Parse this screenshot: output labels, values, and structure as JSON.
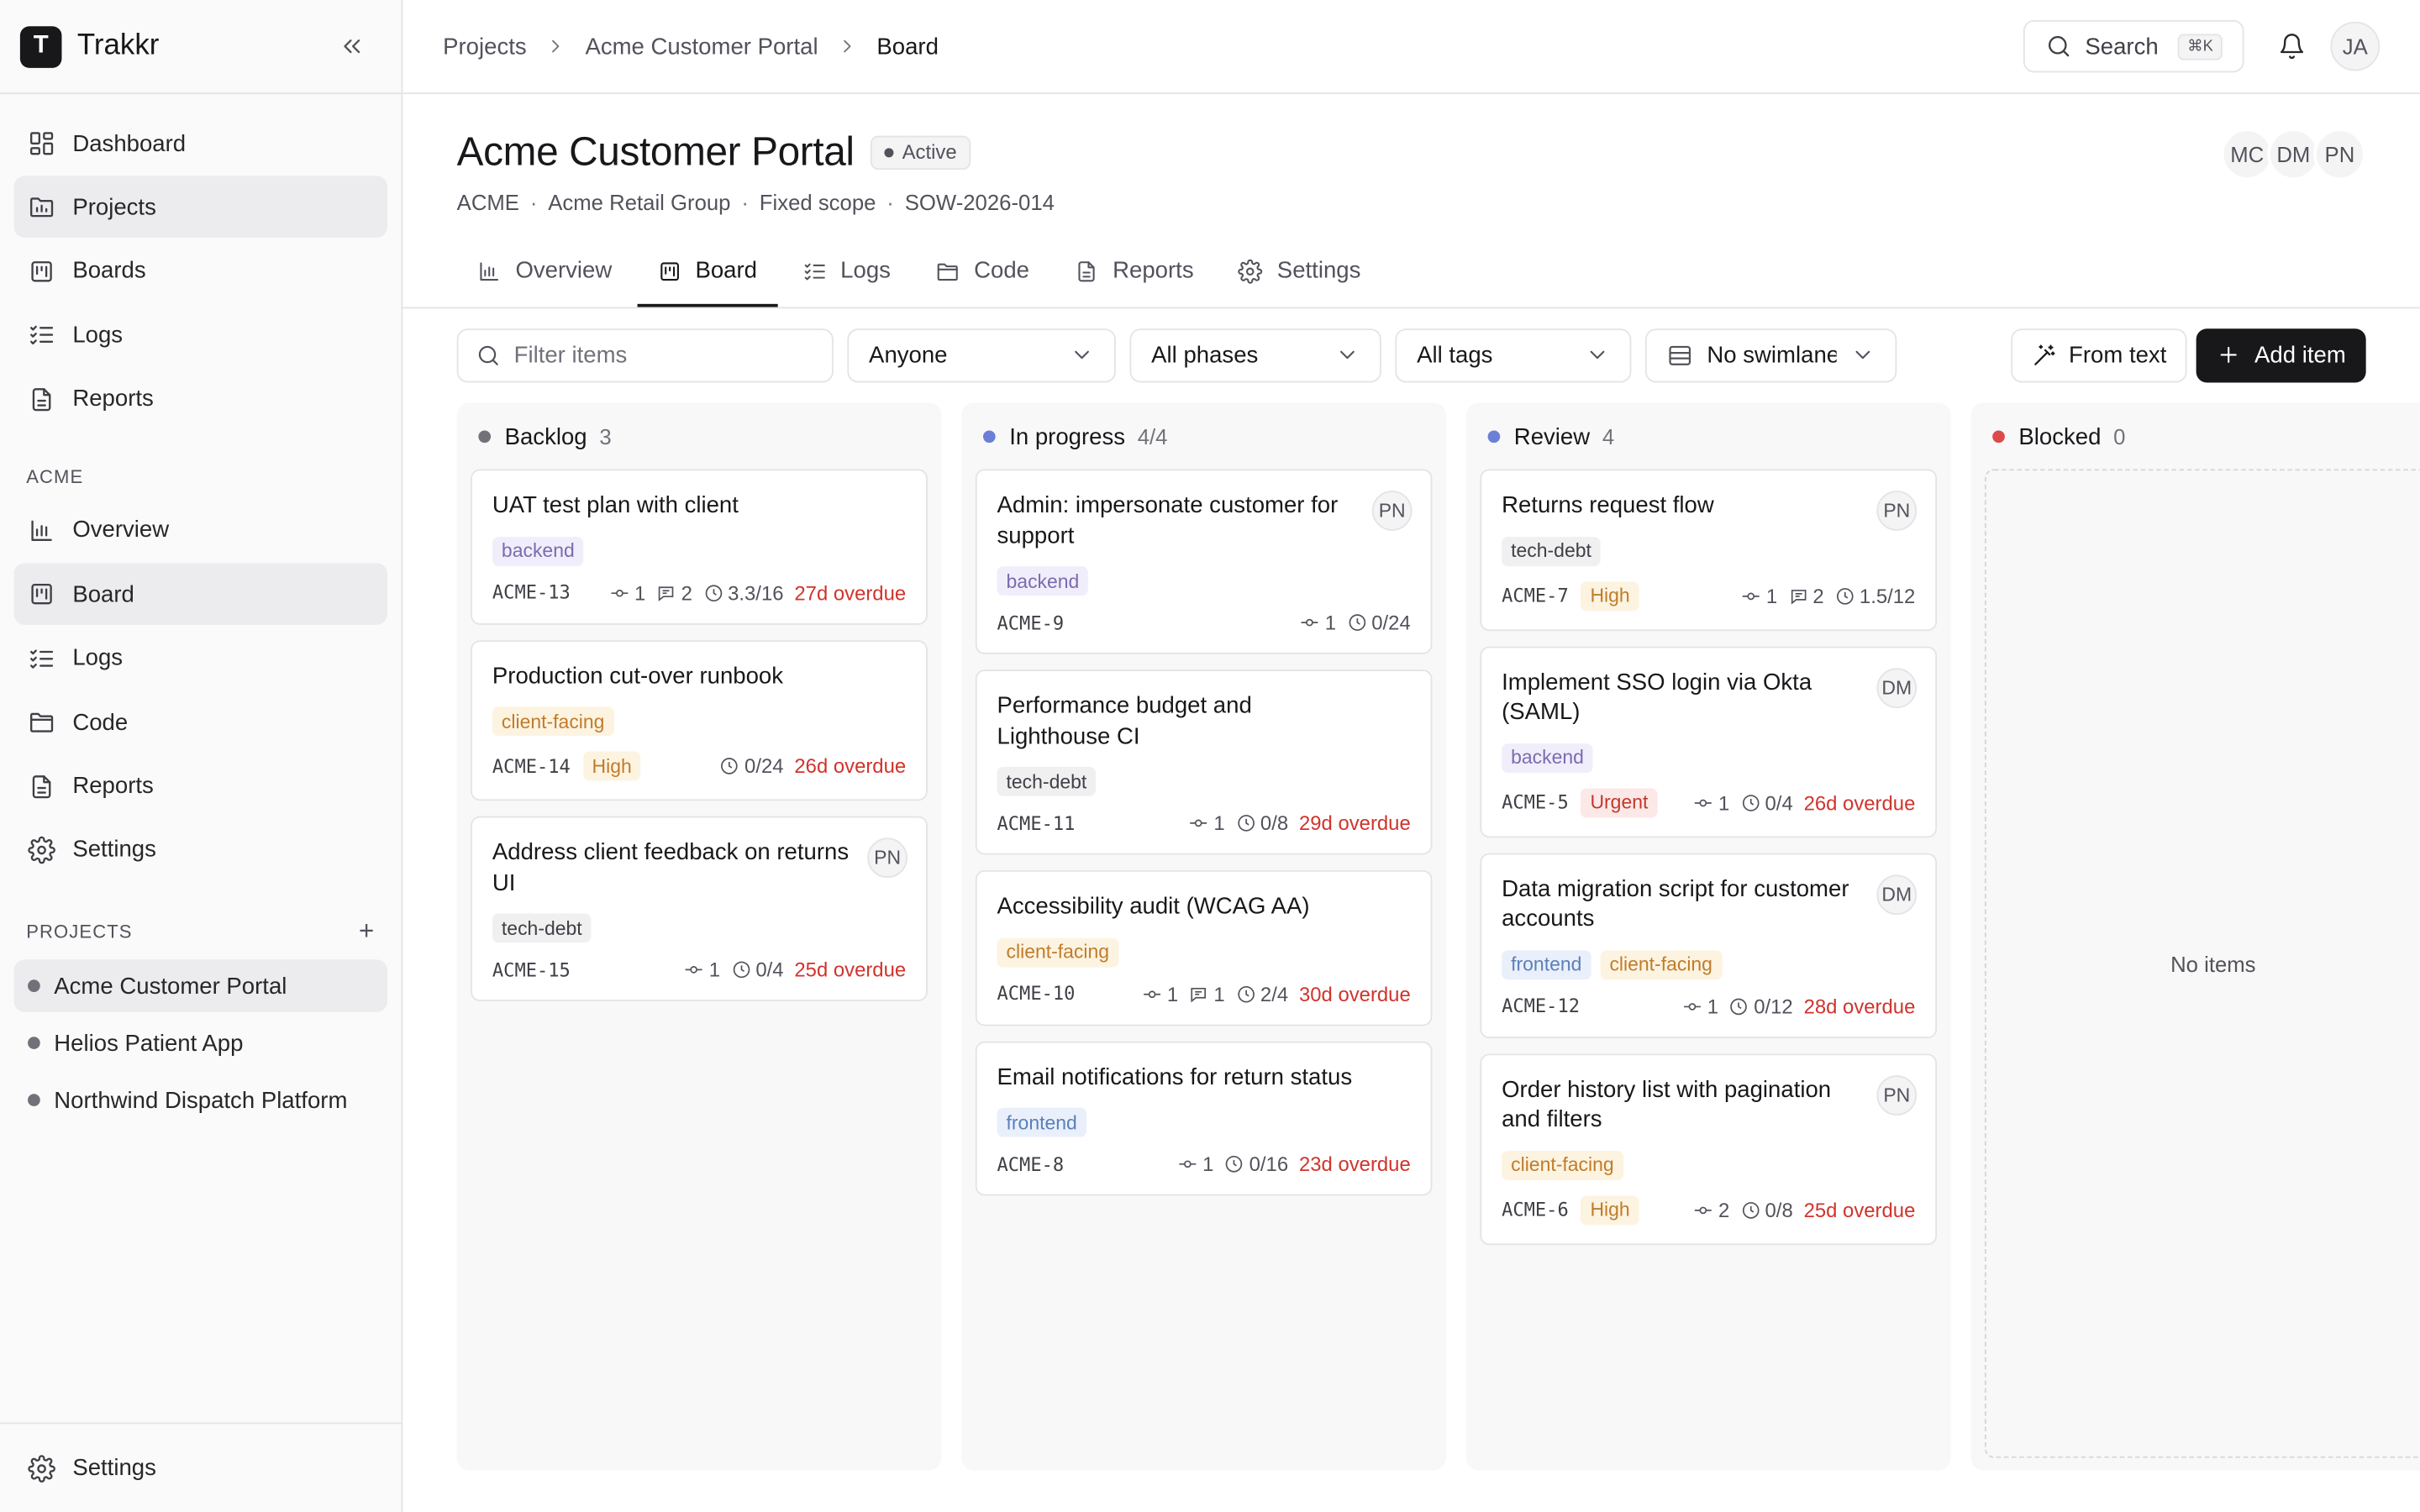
{
  "app": {
    "logo_letter": "T",
    "name": "Trakkr"
  },
  "sidebar": {
    "nav": [
      {
        "label": "Dashboard",
        "icon": "dashboard-icon"
      },
      {
        "label": "Projects",
        "icon": "folder-icon",
        "active": true
      },
      {
        "label": "Boards",
        "icon": "board-icon"
      },
      {
        "label": "Logs",
        "icon": "list-checks-icon"
      },
      {
        "label": "Reports",
        "icon": "document-icon"
      }
    ],
    "section_label": "ACME",
    "section_nav": [
      {
        "label": "Overview",
        "icon": "bar-chart-icon"
      },
      {
        "label": "Board",
        "icon": "board-icon",
        "active": true
      },
      {
        "label": "Logs",
        "icon": "list-checks-icon"
      },
      {
        "label": "Code",
        "icon": "folder-icon"
      },
      {
        "label": "Reports",
        "icon": "document-icon"
      },
      {
        "label": "Settings",
        "icon": "gear-icon"
      }
    ],
    "projects_label": "PROJECTS",
    "add_symbol": "+",
    "projects": [
      {
        "label": "Acme Customer Portal",
        "active": true
      },
      {
        "label": "Helios Patient App"
      },
      {
        "label": "Northwind Dispatch Platform"
      }
    ],
    "footer_label": "Settings"
  },
  "topbar": {
    "breadcrumb": [
      "Projects",
      "Acme Customer Portal",
      "Board"
    ],
    "search_label": "Search",
    "search_shortcut": "⌘K",
    "user_initials": "JA"
  },
  "project": {
    "title": "Acme Customer Portal",
    "status": "Active",
    "meta": [
      "ACME",
      "Acme Retail Group",
      "Fixed scope",
      "SOW-2026-014"
    ],
    "team": [
      "MC",
      "DM",
      "PN"
    ]
  },
  "tabs": [
    {
      "label": "Overview",
      "icon": "bar-chart-icon"
    },
    {
      "label": "Board",
      "icon": "board-icon",
      "active": true
    },
    {
      "label": "Logs",
      "icon": "list-checks-icon"
    },
    {
      "label": "Code",
      "icon": "folder-icon"
    },
    {
      "label": "Reports",
      "icon": "document-icon"
    },
    {
      "label": "Settings",
      "icon": "gear-icon"
    }
  ],
  "toolbar": {
    "filter_placeholder": "Filter items",
    "assignee": "Anyone",
    "phase": "All phases",
    "tags": "All tags",
    "swimlane": "No swimlane",
    "from_text": "From text",
    "add_item": "Add item"
  },
  "colors": {
    "backlog": "#71717a",
    "in_progress": "#6b7fd7",
    "review": "#6b7fd7",
    "blocked": "#dc4a4a"
  },
  "columns": [
    {
      "name": "Backlog",
      "count": "3",
      "dot_color": "#71717a",
      "cards": [
        {
          "title": "UAT test plan with client",
          "tags": [
            "backend"
          ],
          "id": "ACME-13",
          "links": "1",
          "comments": "2",
          "time": "3.3/16",
          "overdue": "27d overdue"
        },
        {
          "title": "Production cut-over runbook",
          "tags": [
            "client-facing"
          ],
          "id": "ACME-14",
          "priority": "High",
          "time": "0/24",
          "overdue": "26d overdue"
        },
        {
          "title": "Address client feedback on returns UI",
          "assignee": "PN",
          "tags": [
            "tech-debt"
          ],
          "id": "ACME-15",
          "links": "1",
          "time": "0/4",
          "overdue": "25d overdue"
        }
      ]
    },
    {
      "name": "In progress",
      "count": "4/4",
      "dot_color": "#6b7fd7",
      "cards": [
        {
          "title": "Admin: impersonate customer for support",
          "assignee": "PN",
          "tags": [
            "backend"
          ],
          "id": "ACME-9",
          "links": "1",
          "time": "0/24"
        },
        {
          "title": "Performance budget and Lighthouse CI",
          "tags": [
            "tech-debt"
          ],
          "id": "ACME-11",
          "links": "1",
          "time": "0/8",
          "overdue": "29d overdue"
        },
        {
          "title": "Accessibility audit (WCAG AA)",
          "tags": [
            "client-facing"
          ],
          "id": "ACME-10",
          "links": "1",
          "comments": "1",
          "time": "2/4",
          "overdue": "30d overdue"
        },
        {
          "title": "Email notifications for return status",
          "tags": [
            "frontend"
          ],
          "id": "ACME-8",
          "links": "1",
          "time": "0/16",
          "overdue": "23d overdue"
        }
      ]
    },
    {
      "name": "Review",
      "count": "4",
      "dot_color": "#6b7fd7",
      "cards": [
        {
          "title": "Returns request flow",
          "assignee": "PN",
          "tags": [
            "tech-debt"
          ],
          "id": "ACME-7",
          "priority": "High",
          "links": "1",
          "comments": "2",
          "time": "1.5/12"
        },
        {
          "title": "Implement SSO login via Okta (SAML)",
          "assignee": "DM",
          "tags": [
            "backend"
          ],
          "id": "ACME-5",
          "priority": "Urgent",
          "links": "1",
          "time": "0/4",
          "overdue": "26d overdue"
        },
        {
          "title": "Data migration script for customer accounts",
          "assignee": "DM",
          "tags": [
            "frontend",
            "client-facing"
          ],
          "id": "ACME-12",
          "links": "1",
          "time": "0/12",
          "overdue": "28d overdue"
        },
        {
          "title": "Order history list with pagination and filters",
          "assignee": "PN",
          "tags": [
            "client-facing"
          ],
          "id": "ACME-6",
          "priority": "High",
          "links": "2",
          "time": "0/8",
          "overdue": "25d overdue"
        }
      ]
    },
    {
      "name": "Blocked",
      "count": "0",
      "dot_color": "#dc4a4a",
      "empty_text": "No items",
      "cards": []
    }
  ]
}
